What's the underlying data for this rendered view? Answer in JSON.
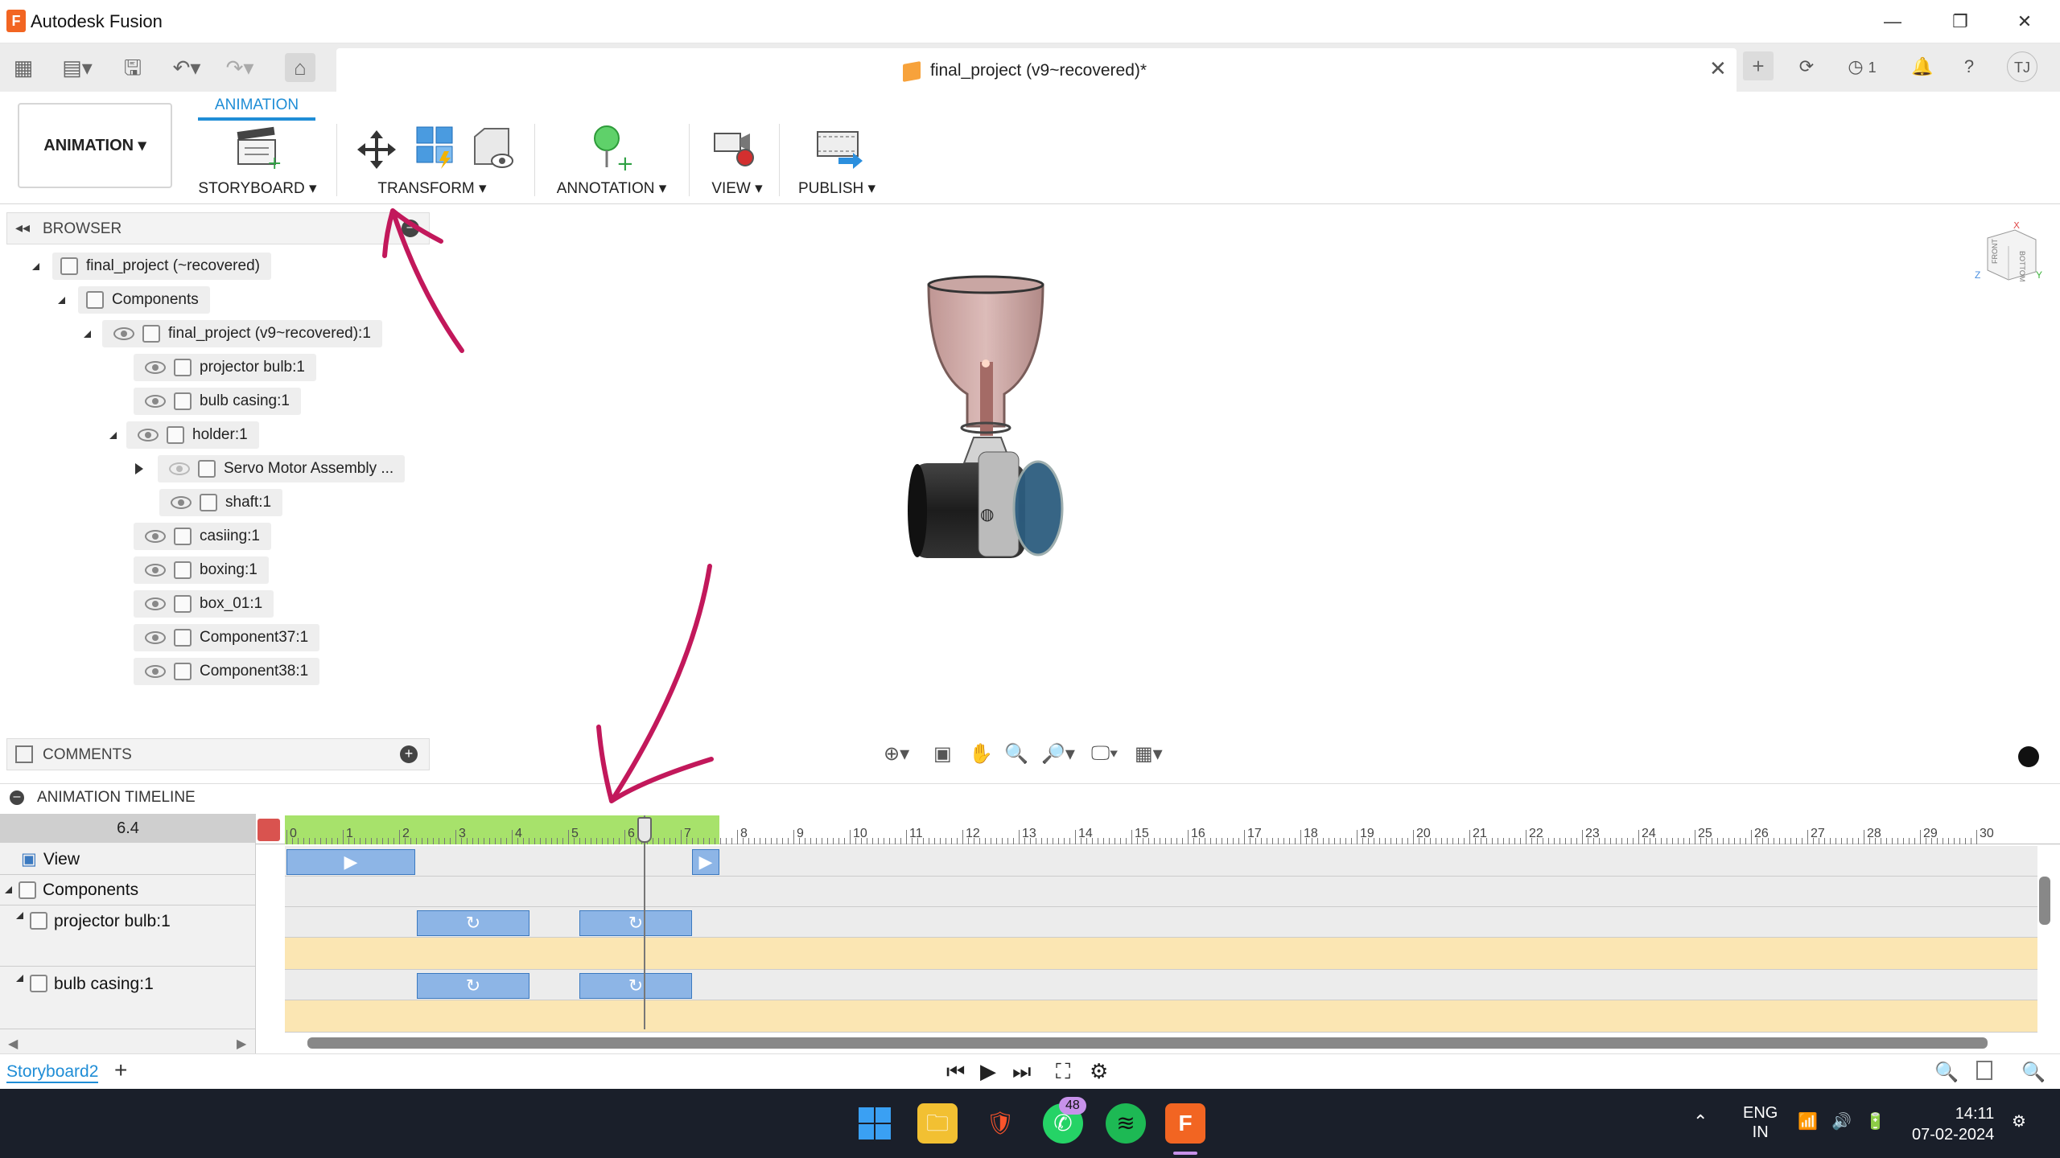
{
  "window": {
    "title": "Autodesk Fusion",
    "app_icon": "F"
  },
  "tabbar": {
    "doc_title": "final_project (v9~recovered)*",
    "jobs_count": "1",
    "user_initials": "TJ"
  },
  "ribbon": {
    "workspace": "ANIMATION ▾",
    "tab": "ANIMATION",
    "groups": {
      "storyboard": "STORYBOARD ▾",
      "transform": "TRANSFORM ▾",
      "annotation": "ANNOTATION ▾",
      "view": "VIEW ▾",
      "publish": "PUBLISH ▾"
    }
  },
  "browser": {
    "title": "BROWSER",
    "tree": [
      {
        "label": "final_project (~recovered)"
      },
      {
        "label": "Components"
      },
      {
        "label": "final_project (v9~recovered):1"
      },
      {
        "label": "projector bulb:1"
      },
      {
        "label": "bulb casing:1"
      },
      {
        "label": "holder:1"
      },
      {
        "label": "Servo Motor Assembly ..."
      },
      {
        "label": "shaft:1"
      },
      {
        "label": "casiing:1"
      },
      {
        "label": "boxing:1"
      },
      {
        "label": "box_01:1"
      },
      {
        "label": "Component37:1"
      },
      {
        "label": "Component38:1"
      }
    ]
  },
  "comments": {
    "title": "COMMENTS"
  },
  "timeline": {
    "title": "ANIMATION TIMELINE",
    "current_time": "6.4",
    "ticks": [
      "0",
      "1",
      "2",
      "3",
      "4",
      "5",
      "6",
      "7",
      "8",
      "9",
      "10",
      "11",
      "12",
      "13",
      "14",
      "15",
      "16",
      "17",
      "18",
      "19",
      "20",
      "21",
      "22",
      "23",
      "24",
      "25",
      "26",
      "27",
      "28",
      "29",
      "30"
    ],
    "tracks": {
      "view": "View",
      "components": "Components",
      "projector_bulb": "projector bulb:1",
      "bulb_casing": "bulb casing:1"
    },
    "storyboard_tab": "Storyboard2"
  },
  "taskbar": {
    "whatsapp_badge": "48",
    "lang_1": "ENG",
    "lang_2": "IN",
    "time": "14:11",
    "date": "07-02-2024"
  },
  "colors": {
    "accent": "#1f8dd6",
    "timeline_green": "#a7e26b",
    "clip_blue": "#8db5e6",
    "lane_yellow": "#fbe6b3",
    "annotation_pen": "#c2185b"
  }
}
